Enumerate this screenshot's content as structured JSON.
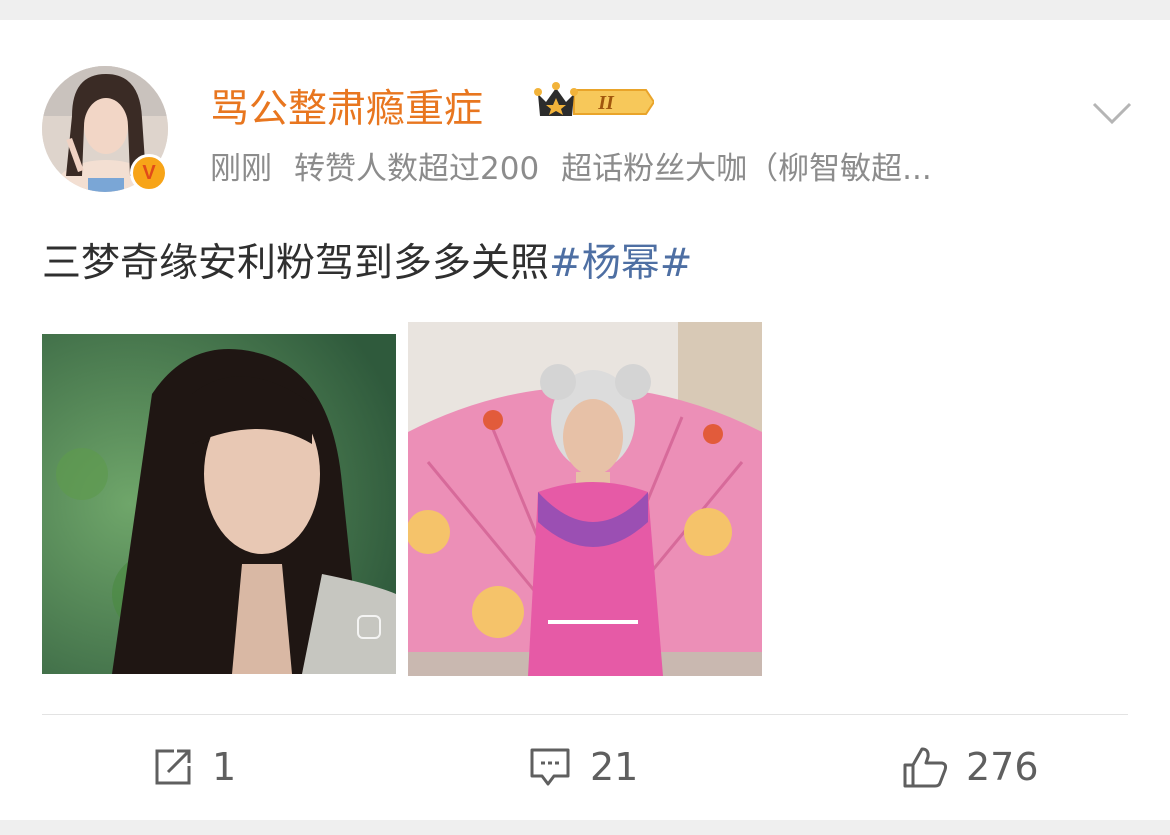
{
  "post": {
    "author": {
      "name": "骂公整肃瘾重症",
      "verified_label": "V",
      "fan_level": "II"
    },
    "meta": {
      "time": "刚刚",
      "repost_note": "转赞人数超过200",
      "super_topic": "超话粉丝大咖（柳智敏超..."
    },
    "text": "三梦奇缘安利粉驾到多多关照",
    "topic": "#杨幂#",
    "images": [
      {
        "name": "woman-portrait-green-background"
      },
      {
        "name": "pink-cosplay-with-fan"
      }
    ]
  },
  "actions": {
    "repost_count": "1",
    "comment_count": "21",
    "like_count": "276"
  },
  "colors": {
    "username": "#e8761f",
    "topic": "#4e6fa3",
    "meta": "#8c8c8c",
    "text": "#2f2f2f"
  }
}
